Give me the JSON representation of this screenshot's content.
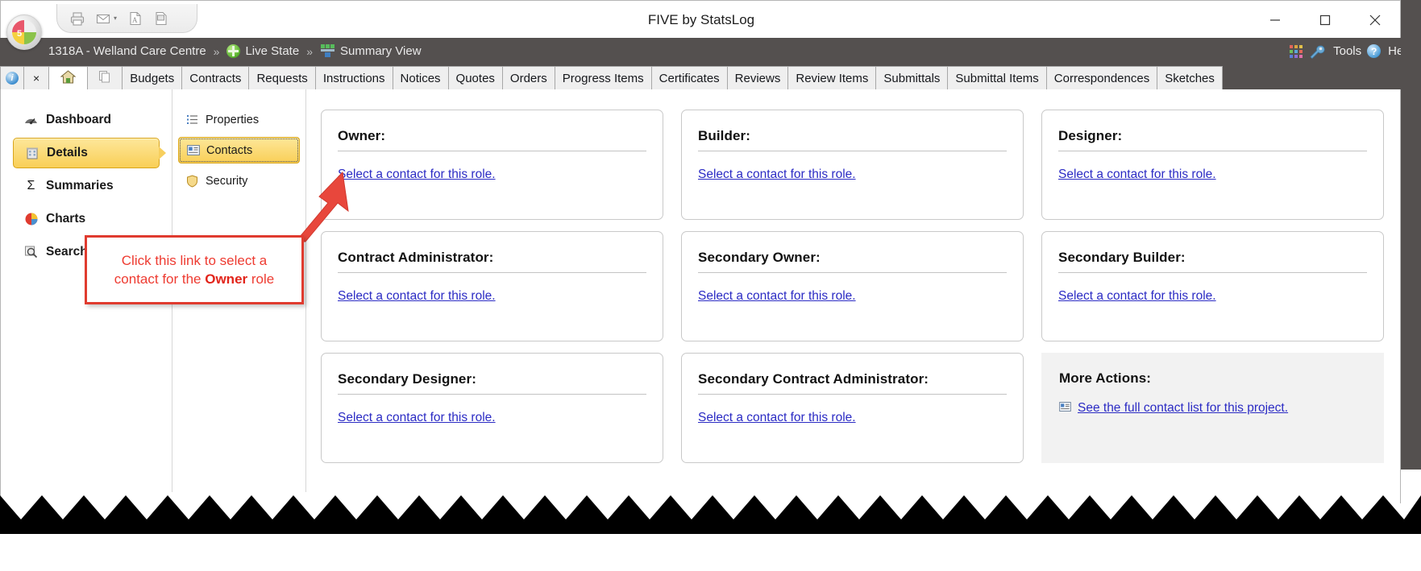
{
  "window": {
    "title": "FIVE by StatsLog",
    "minimize_label": "Minimize",
    "maximize_label": "Maximize",
    "close_label": "Close"
  },
  "quick_access_toolbar": {
    "buttons": [
      {
        "name": "print-icon",
        "label": "Print"
      },
      {
        "name": "email-icon",
        "label": "Email"
      },
      {
        "name": "email-dropdown-caret-icon",
        "label": "▾"
      },
      {
        "name": "pdf-export-icon",
        "label": "Export to PDF"
      },
      {
        "name": "excel-export-icon",
        "label": "Export to Excel"
      }
    ]
  },
  "breadcrumb": {
    "items": [
      {
        "label": "1318A - Welland Care Centre",
        "icon": ""
      },
      {
        "label": "Live State",
        "icon": "live-state-icon"
      },
      {
        "label": "Summary View",
        "icon": "summary-view-icon"
      }
    ],
    "separator": "»"
  },
  "topright": {
    "apps_label": "apps-grid-icon",
    "tools_label": "Tools",
    "help_label": "Help"
  },
  "tabs": [
    {
      "label": "",
      "icon": "info-icon",
      "type": "system"
    },
    {
      "label": "×",
      "icon": "close-tab-icon",
      "type": "system"
    },
    {
      "label": "",
      "icon": "home-icon",
      "type": "home",
      "active": true
    },
    {
      "label": "",
      "icon": "copy-icon",
      "type": "system"
    },
    {
      "label": "Budgets"
    },
    {
      "label": "Contracts"
    },
    {
      "label": "Requests"
    },
    {
      "label": "Instructions"
    },
    {
      "label": "Notices"
    },
    {
      "label": "Quotes"
    },
    {
      "label": "Orders"
    },
    {
      "label": "Progress Items"
    },
    {
      "label": "Certificates"
    },
    {
      "label": "Reviews"
    },
    {
      "label": "Review Items"
    },
    {
      "label": "Submittals"
    },
    {
      "label": "Submittal Items"
    },
    {
      "label": "Correspondences"
    },
    {
      "label": "Sketches"
    }
  ],
  "sidebar": {
    "items": [
      {
        "label": "Dashboard",
        "icon": "gauge-icon",
        "active": false
      },
      {
        "label": "Details",
        "icon": "building-icon",
        "active": true
      },
      {
        "label": "Summaries",
        "icon": "sigma-icon",
        "active": false
      },
      {
        "label": "Charts",
        "icon": "pie-chart-icon",
        "active": false
      },
      {
        "label": "Search",
        "icon": "magnifier-icon",
        "active": false
      }
    ]
  },
  "subnav": {
    "items": [
      {
        "label": "Properties",
        "icon": "list-icon",
        "active": false
      },
      {
        "label": "Contacts",
        "icon": "contact-card-icon",
        "active": true
      },
      {
        "label": "Security",
        "icon": "shield-icon",
        "active": false
      }
    ]
  },
  "cards": [
    {
      "title": "Owner:",
      "link": "Select a contact for this role.",
      "kind": "role"
    },
    {
      "title": "Builder:",
      "link": "Select a contact for this role.",
      "kind": "role"
    },
    {
      "title": "Designer:",
      "link": "Select a contact for this role.",
      "kind": "role"
    },
    {
      "title": "Contract Administrator:",
      "link": "Select a contact for this role.",
      "kind": "role"
    },
    {
      "title": "Secondary Owner:",
      "link": "Select a contact for this role.",
      "kind": "role"
    },
    {
      "title": "Secondary Builder:",
      "link": "Select a contact for this role.",
      "kind": "role"
    },
    {
      "title": "Secondary Designer:",
      "link": "Select a contact for this role.",
      "kind": "role"
    },
    {
      "title": "Secondary Contract Administrator:",
      "link": "Select a contact for this role.",
      "kind": "role"
    },
    {
      "title": "More Actions:",
      "link": "See the full contact list for this project.",
      "kind": "actions"
    }
  ],
  "callout": {
    "line1": "Click this link to select a",
    "line2_pre": "contact for the ",
    "line2_bold": "Owner",
    "line2_post": " role",
    "border_color": "#e03b2f",
    "text_color": "#ee3b31"
  },
  "colors": {
    "chrome": "#54504f",
    "accent_yellow": "#f9cf57",
    "link_blue": "#2b2bc4",
    "annotation_red": "#e03b2f"
  }
}
